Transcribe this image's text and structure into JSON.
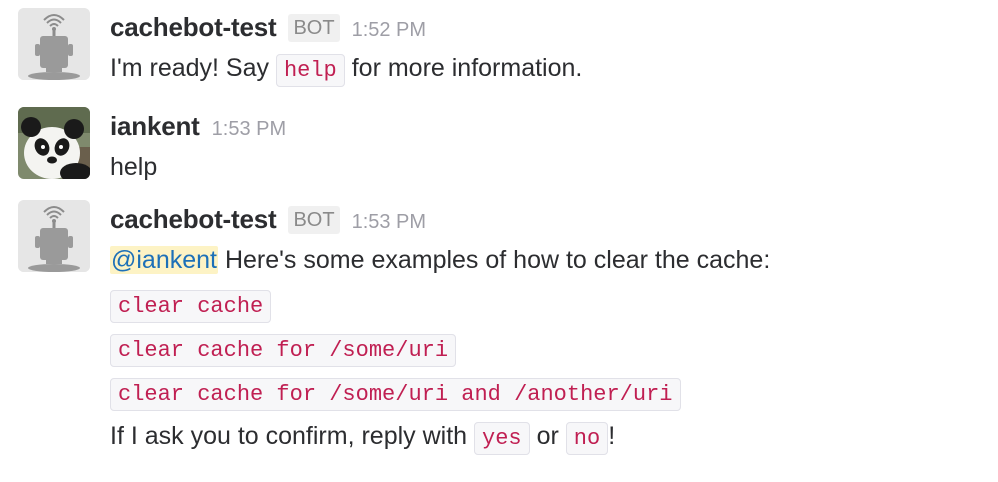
{
  "messages": [
    {
      "sender": "cachebot-test",
      "badge": "BOT",
      "time": "1:52 PM",
      "avatar_icon": "antenna-robot-icon",
      "text_before": "I'm ready! Say",
      "code": "help",
      "text_after": "for more information."
    },
    {
      "sender": "iankent",
      "time": "1:53 PM",
      "avatar_icon": "panda-avatar",
      "text": "help"
    },
    {
      "sender": "cachebot-test",
      "badge": "BOT",
      "time": "1:53 PM",
      "avatar_icon": "antenna-robot-icon",
      "mention": "@iankent",
      "intro": "Here's some examples of how to clear the cache:",
      "examples": [
        "clear cache",
        "clear cache for /some/uri",
        "clear cache for /some/uri and /another/uri"
      ],
      "confirm_before": "If I ask you to confirm, reply with",
      "confirm_yes": "yes",
      "confirm_or": "or",
      "confirm_no": "no",
      "confirm_after": "!"
    }
  ],
  "colors": {
    "code_text": "#c01f52",
    "code_background": "#f7f7f9",
    "mention_text": "#1d70b8",
    "mention_background": "#fdf3c5",
    "timestamp": "#9e9ea6"
  }
}
